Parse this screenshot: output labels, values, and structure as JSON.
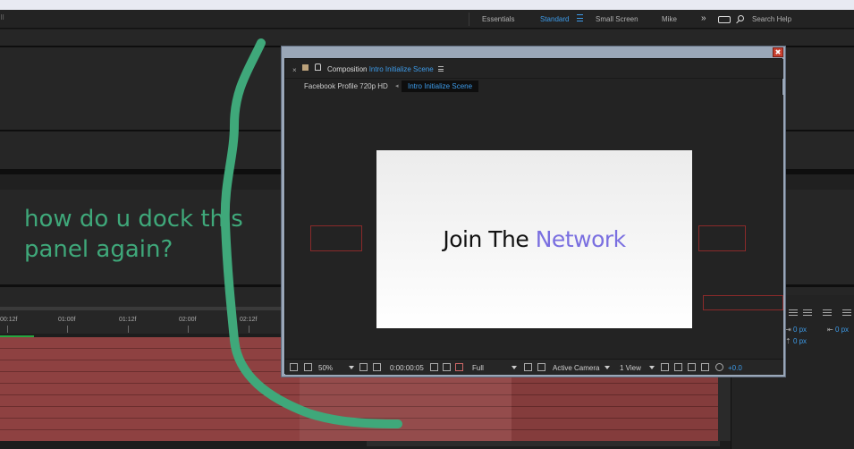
{
  "workspaces": {
    "items": [
      "Essentials",
      "Standard",
      "Small Screen",
      "Mike"
    ],
    "active": "Standard",
    "search_label": "Search Help"
  },
  "annotation": {
    "line1": "how do u dock this",
    "line2": "panel again?"
  },
  "timeline": {
    "ticks": [
      "00:12f",
      "01:00f",
      "01:12f",
      "02:00f",
      "02:12f"
    ]
  },
  "properties": {
    "px_1": "0 px",
    "px_2": "0 px",
    "px_3": "0 px"
  },
  "comp_panel": {
    "close_glyph": "×",
    "label": "Composition",
    "comp_name": "Intro Initialize Scene",
    "breadcrumbs": [
      "Facebook Profile 720p HD",
      "Intro Initialize Scene"
    ],
    "window_close_glyph": "✖"
  },
  "canvas": {
    "headline_plain": "Join The ",
    "headline_accent": "Network"
  },
  "viewer_bar": {
    "zoom": "50%",
    "timecode": "0:00:00:05",
    "resolution": "Full",
    "camera": "Active Camera",
    "views": "1 View",
    "exposure": "+0.0"
  },
  "colors": {
    "accent_blue": "#3d9be9",
    "annotation_green": "#3fa87a",
    "track_red": "#8e4141",
    "headline_purple": "#7a6fe0"
  }
}
